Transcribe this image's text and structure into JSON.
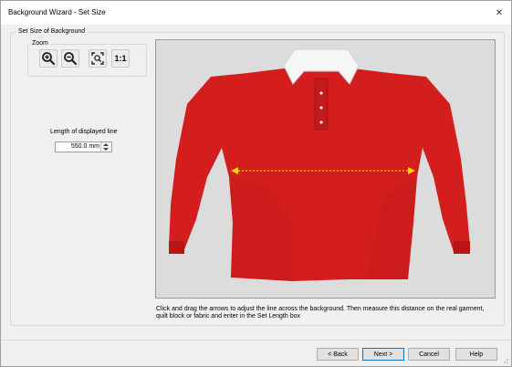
{
  "window": {
    "title": "Background Wizard - Set Size",
    "close_glyph": "✕"
  },
  "group": {
    "label": "Set Size of Background"
  },
  "zoom": {
    "label": "Zoom",
    "buttons": [
      {
        "icon": "zoom-in-icon"
      },
      {
        "icon": "zoom-out-icon"
      },
      {
        "icon": "zoom-to-fit-icon"
      },
      {
        "label": "1:1"
      }
    ]
  },
  "length": {
    "label": "Length of displayed line",
    "value": "550.0 mm"
  },
  "preview": {
    "description_icon": "red-shirt-image",
    "colors": {
      "shirt": "#d41e1e",
      "background": "#dcdcdc",
      "measure_line": "#ffd400"
    }
  },
  "instructions": "Click and drag the arrows to adjust the line across the background. Then measure this distance on the real garment, quilt block or fabric and enter in the Set Length box",
  "buttons": {
    "back": "< Back",
    "next": "Next >",
    "cancel": "Cancel",
    "help": "Help"
  }
}
